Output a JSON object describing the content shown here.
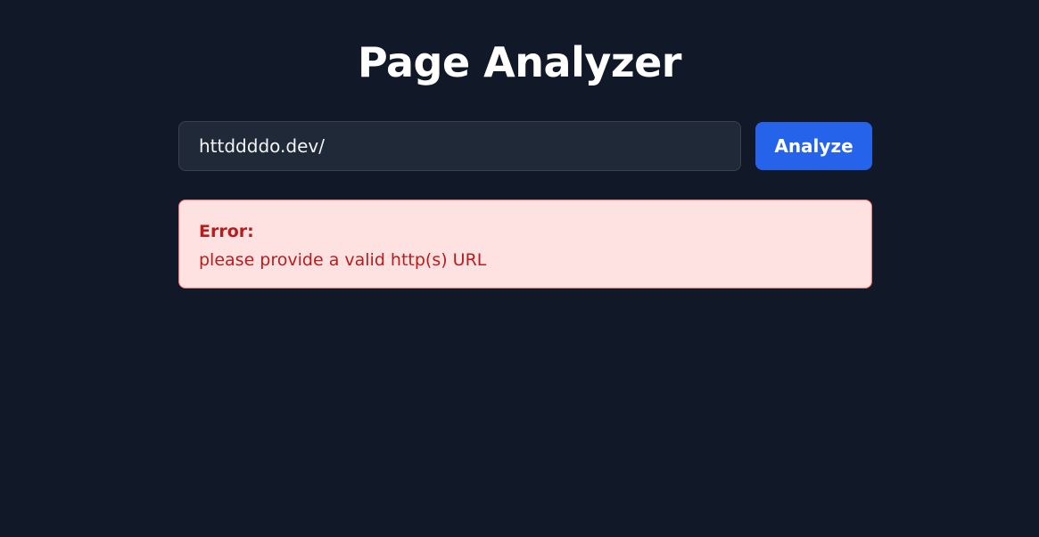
{
  "header": {
    "title": "Page Analyzer"
  },
  "form": {
    "url_value": "httddddo.dev/",
    "analyze_label": "Analyze"
  },
  "error": {
    "title": "Error:",
    "message": "please provide a valid http(s) URL"
  },
  "colors": {
    "background": "#111827",
    "input_background": "#1f2937",
    "accent": "#2563eb",
    "error_background": "#fee2e2",
    "error_border": "#f87171",
    "error_text": "#b91c1c"
  }
}
